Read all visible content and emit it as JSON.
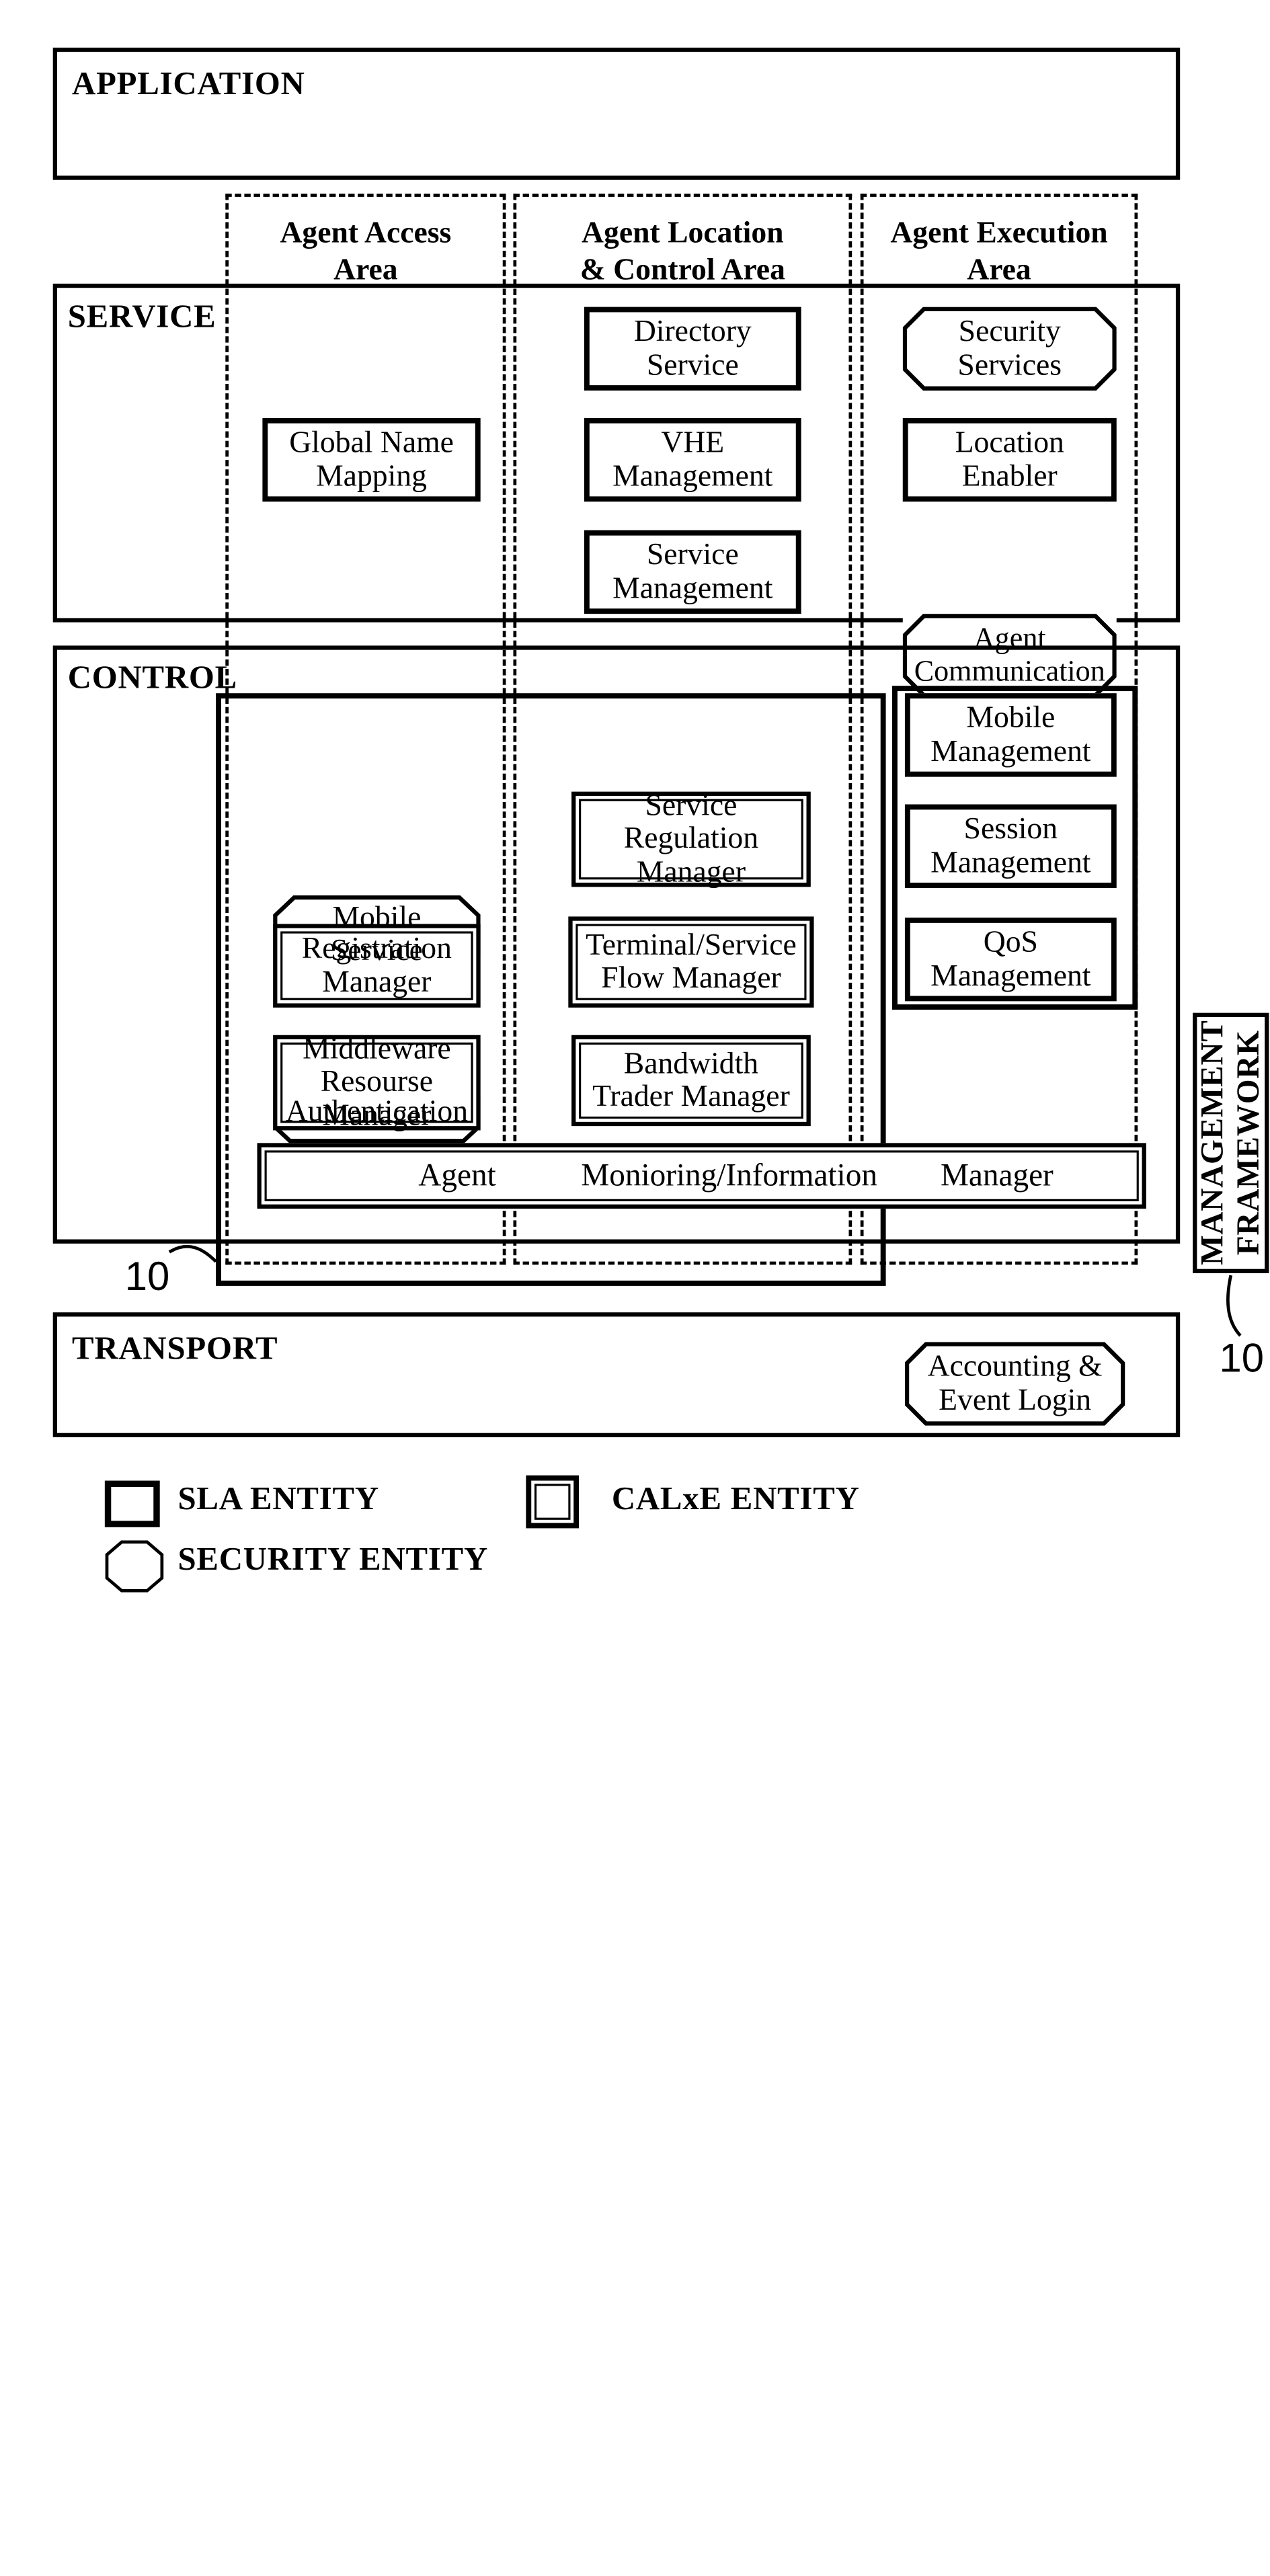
{
  "figure": {
    "reference_numerals": [
      "10",
      "10"
    ]
  },
  "layers": [
    {
      "id": "application",
      "label": "APPLICATION"
    },
    {
      "id": "service",
      "label": "SERVICE"
    },
    {
      "id": "control",
      "label": "CONTROL"
    },
    {
      "id": "transport",
      "label": "TRANSPORT"
    }
  ],
  "areas": [
    {
      "id": "agent-access",
      "label": "Agent Access\nArea"
    },
    {
      "id": "agent-location-control",
      "label": "Agent Location\n& Control Area"
    },
    {
      "id": "agent-execution",
      "label": "Agent Execution\nArea"
    }
  ],
  "service_layer": {
    "agent_access": [
      {
        "label": "Global Name\nMapping",
        "entity": "sla"
      }
    ],
    "agent_location_control": [
      {
        "label": "Directory\nService",
        "entity": "sla"
      },
      {
        "label": "VHE\nManagement",
        "entity": "sla"
      },
      {
        "label": "Service\nManagement",
        "entity": "sla"
      }
    ],
    "agent_execution": [
      {
        "label": "Security\nServices",
        "entity": "security"
      },
      {
        "label": "Location\nEnabler",
        "entity": "sla"
      },
      {
        "label": "Agent\nCommunication",
        "entity": "security"
      }
    ]
  },
  "control_layer": {
    "agent_access": [
      {
        "label": "Mobile\nService",
        "entity": "security"
      },
      {
        "label": "Authentication",
        "entity": "security"
      },
      {
        "label": "Registration\nManager",
        "entity": "calxe"
      },
      {
        "label": "Middleware\nResourse\nManager",
        "entity": "calxe"
      }
    ],
    "agent_location_control": [
      {
        "label": "Service\nRegulation\nManager",
        "entity": "calxe"
      },
      {
        "label": "Terminal/Service\nFlow Manager",
        "entity": "calxe"
      },
      {
        "label": "Bandwidth\nTrader Manager",
        "entity": "calxe"
      }
    ],
    "agent_execution": [
      {
        "label": "Mobile\nManagement",
        "entity": "sla"
      },
      {
        "label": "Session\nManagement",
        "entity": "sla"
      },
      {
        "label": "QoS\nManagement",
        "entity": "sla"
      },
      {
        "label": "Accounting &\nEvent Login",
        "entity": "security"
      }
    ],
    "bottom_bar": {
      "entity": "calxe",
      "cells": [
        "Agent",
        "Monioring/Information",
        "Manager"
      ]
    }
  },
  "management_framework": {
    "label": "MANAGEMENT\nFRAMEWORK"
  },
  "legend": [
    {
      "id": "sla",
      "label": "SLA ENTITY",
      "shape": "rectangle-bold"
    },
    {
      "id": "calxe",
      "label": "CALxE ENTITY",
      "shape": "rectangle-double"
    },
    {
      "id": "security",
      "label": "SECURITY ENTITY",
      "shape": "octagon"
    }
  ]
}
